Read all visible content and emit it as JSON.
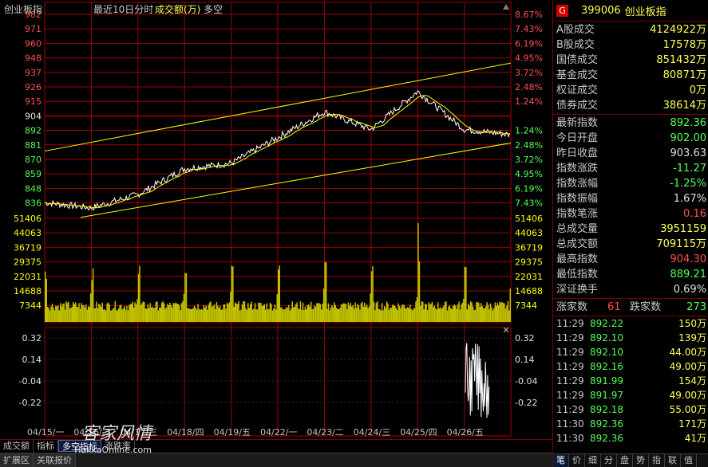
{
  "header": {
    "name": "创业板指",
    "mode": "最近10日分时",
    "indicator": "成交额(万)",
    "extra": "多空"
  },
  "icons": {
    "scroll_up": "triangle-up-icon",
    "close": "close-icon",
    "zoom_in": "plus-icon",
    "zoom_out": "minus-icon"
  },
  "colors": {
    "background": "#000000",
    "grid": "#a00000",
    "price": "#ffffff",
    "avg": "#ffff00",
    "volume": "#c0c000",
    "up": "#ff5050",
    "down": "#54ff54",
    "channel": "#ffff00"
  },
  "chart_data": [
    {
      "type": "line",
      "series": [
        {
          "x": [
            "04/15",
            "04/16",
            "04/17",
            "04/18",
            "04/19",
            "04/22",
            "04/23",
            "04/24",
            "04/25",
            "04/26"
          ],
          "values": [
            843,
            839,
            849,
            868,
            872,
            891,
            910,
            897,
            925,
            897
          ]
        }
      ],
      "y_ticks": [
        982,
        971,
        960,
        948,
        937,
        926,
        915,
        904,
        892,
        881,
        870,
        859,
        848,
        836
      ],
      "pct_ticks": [
        "8.67%",
        "7.43%",
        "6.19%",
        "4.95%",
        "3.72%",
        "2.48%",
        "1.24%",
        "1.24%",
        "2.48%",
        "3.72%",
        "4.95%",
        "6.19%",
        "7.43%"
      ],
      "x_labels": [
        "04/15/一",
        "04/16/二",
        "04/17/三",
        "04/18/四",
        "04/19/五",
        "04/22/一",
        "04/23/二",
        "04/24/三",
        "04/25/四",
        "04/26/五"
      ],
      "ylim": [
        832,
        982
      ],
      "reference": 904
    },
    {
      "type": "bar",
      "y_ticks": [
        "51406",
        "44063",
        "36719",
        "29375",
        "22031",
        "14688",
        "7344"
      ],
      "ylim": [
        0,
        58750
      ]
    },
    {
      "type": "line",
      "y_ticks": [
        "0.32",
        "0.14",
        "-0.04",
        "-0.22"
      ],
      "ylim": [
        -0.32,
        0.34
      ]
    }
  ],
  "side": {
    "code": "399006",
    "name": "创业板指",
    "g_label": "G",
    "turnover": [
      {
        "label": "A股成交",
        "value": "4124922万"
      },
      {
        "label": "B股成交",
        "value": "17578万"
      },
      {
        "label": "国债成交",
        "value": "851432万"
      },
      {
        "label": "基金成交",
        "value": "80871万"
      },
      {
        "label": "权证成交",
        "value": "0万"
      },
      {
        "label": "债券成交",
        "value": "38614万"
      }
    ],
    "stats": [
      {
        "label": "最新指数",
        "value": "892.36",
        "tone": "grn"
      },
      {
        "label": "今日开盘",
        "value": "902.00",
        "tone": "grn"
      },
      {
        "label": "昨日收盘",
        "value": "903.63",
        "tone": "wht"
      },
      {
        "label": "指数涨跌",
        "value": "-11.27",
        "tone": "grn"
      },
      {
        "label": "指数涨幅",
        "value": "-1.25%",
        "tone": "grn"
      },
      {
        "label": "指数振幅",
        "value": "1.67%",
        "tone": "wht"
      },
      {
        "label": "指数笔涨",
        "value": "0.16",
        "tone": "red"
      },
      {
        "label": "总成交量",
        "value": "3951159",
        "tone": "yel"
      },
      {
        "label": "总成交额",
        "value": "709115万",
        "tone": "yel"
      },
      {
        "label": "最高指数",
        "value": "904.30",
        "tone": "red"
      },
      {
        "label": "最低指数",
        "value": "889.21",
        "tone": "grn"
      },
      {
        "label": "深证换手",
        "value": "0.69%",
        "tone": "wht"
      }
    ],
    "breadth": {
      "up_label": "涨家数",
      "up": "61",
      "down_label": "跌家数",
      "down": "273"
    },
    "ticks": [
      {
        "time": "11:29",
        "price": "892.22",
        "vol": "150万"
      },
      {
        "time": "11:29",
        "price": "892.10",
        "vol": "139万"
      },
      {
        "time": "11:29",
        "price": "892.10",
        "vol": "44.00万"
      },
      {
        "time": "11:29",
        "price": "892.16",
        "vol": "49.00万"
      },
      {
        "time": "11:29",
        "price": "891.99",
        "vol": "154万"
      },
      {
        "time": "11:29",
        "price": "891.97",
        "vol": "49.00万"
      },
      {
        "time": "11:29",
        "price": "892.18",
        "vol": "55.00万"
      },
      {
        "time": "11:30",
        "price": "892.36",
        "vol": "171万"
      },
      {
        "time": "11:30",
        "price": "892.36",
        "vol": "41万"
      }
    ],
    "tabs": [
      "笔",
      "价",
      "细",
      "分",
      "盘",
      "势",
      "指",
      "联",
      "值"
    ]
  },
  "tabs_row1": [
    "成交额",
    "指标",
    "多空指标",
    "涨跌率"
  ],
  "tabs_row2": [
    "扩展区",
    "关联报价"
  ],
  "watermark": {
    "cn": "客家风情",
    "url": "HakkaOnline.com"
  }
}
